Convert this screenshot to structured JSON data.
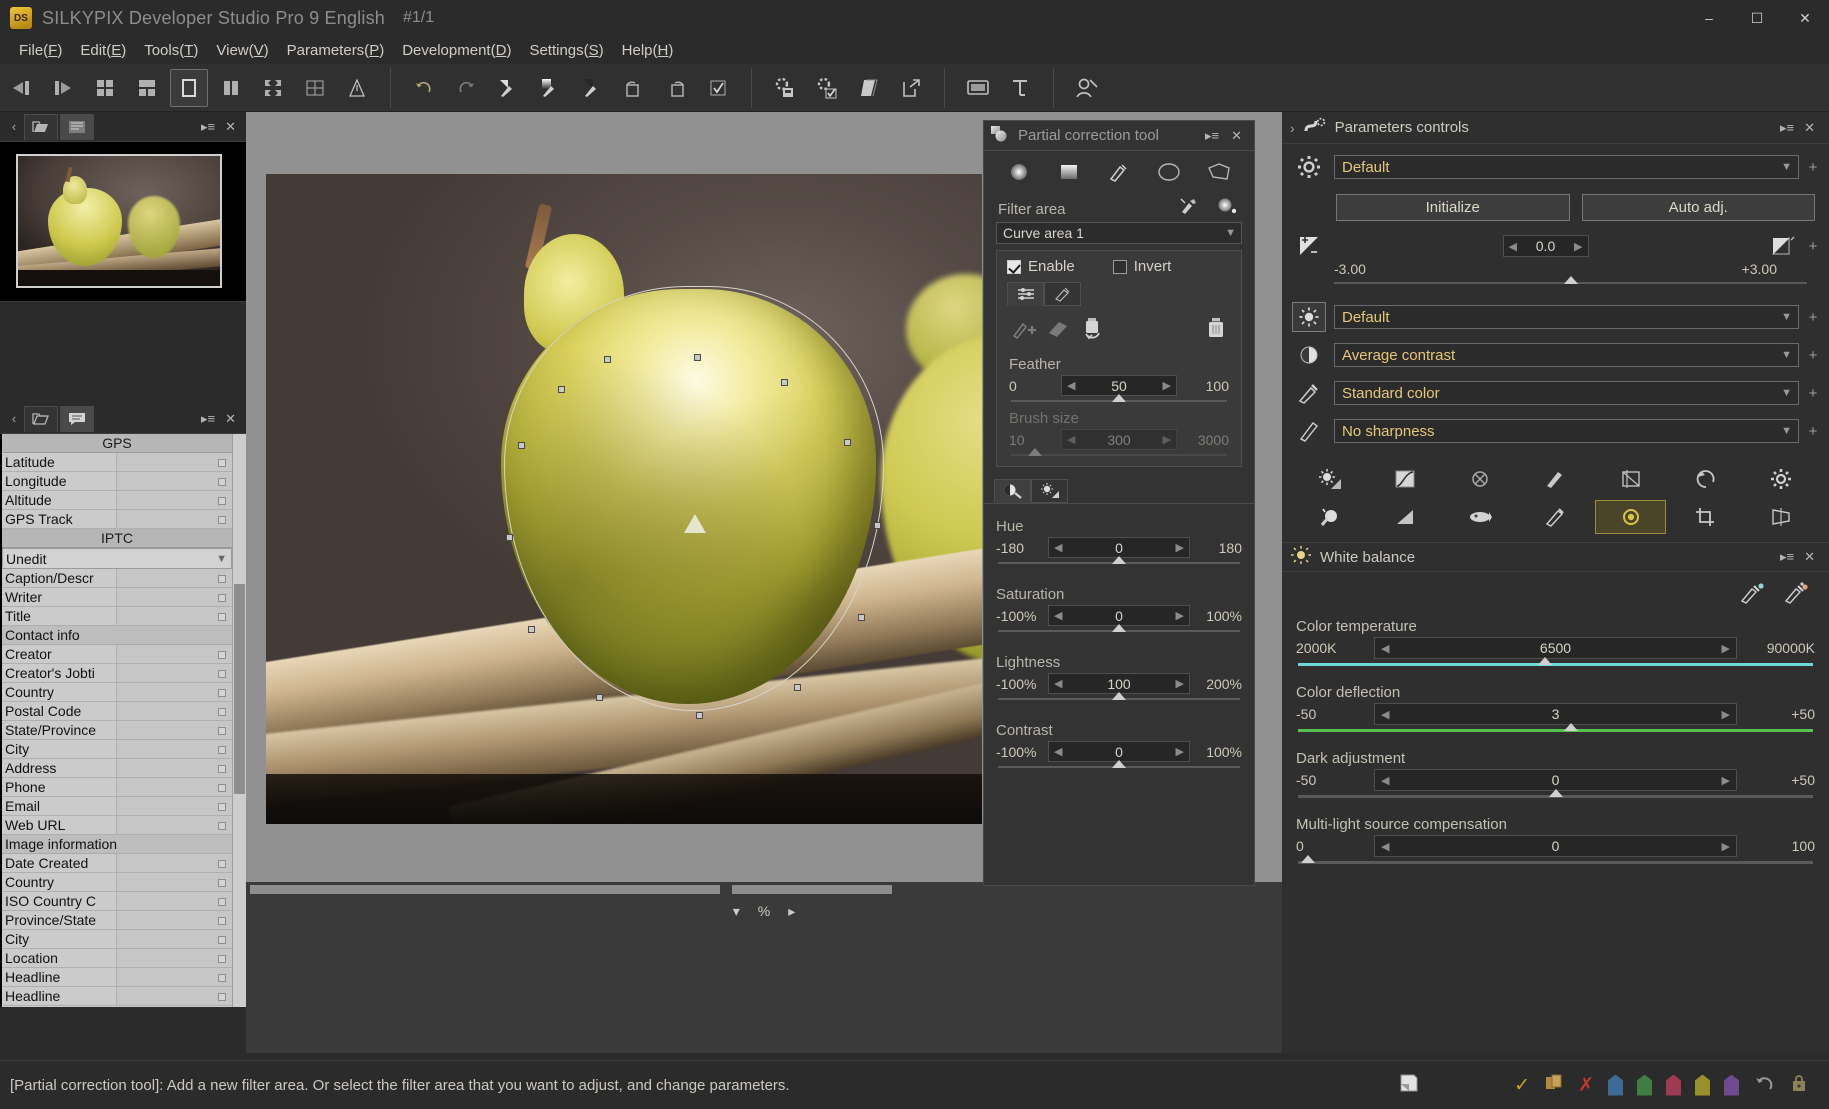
{
  "window": {
    "title": "SILKYPIX Developer Studio Pro 9 English",
    "index": "#1/1",
    "logo_text": "DS",
    "minimize": "–",
    "maximize": "☐",
    "close": "✕"
  },
  "menu": [
    {
      "label": "File",
      "accel": "F"
    },
    {
      "label": "Edit",
      "accel": "E"
    },
    {
      "label": "Tools",
      "accel": "T"
    },
    {
      "label": "View",
      "accel": "V"
    },
    {
      "label": "Parameters",
      "accel": "P"
    },
    {
      "label": "Development",
      "accel": "D"
    },
    {
      "label": "Settings",
      "accel": "S"
    },
    {
      "label": "Help",
      "accel": "H"
    }
  ],
  "toolbar": {
    "groups": [
      [
        "previous-image",
        "next-image",
        "thumbnail-view",
        "combination-view",
        "single-view",
        "compare-view",
        "fit-view",
        "grid-view",
        "warning-view"
      ],
      [
        "undo",
        "redo",
        "taste-tool",
        "gradation-tool",
        "tone-tool",
        "rotate-left",
        "rotate-right",
        "select-check"
      ],
      [
        "batch-develop",
        "develop-check",
        "print",
        "export"
      ],
      [
        "screen-mode",
        "slideshow",
        "text-tool"
      ],
      [
        "user-account"
      ]
    ]
  },
  "left_panel": {
    "tabs": [
      "folder-tab",
      "metadata-tab"
    ],
    "selected_tab": "metadata-tab",
    "thumbnail_label": "",
    "metadata": [
      {
        "type": "section",
        "label": "GPS"
      },
      {
        "type": "row",
        "label": "Latitude",
        "value": ""
      },
      {
        "type": "row",
        "label": "Longitude",
        "value": ""
      },
      {
        "type": "row",
        "label": "Altitude",
        "value": ""
      },
      {
        "type": "row",
        "label": "GPS Track",
        "value": ""
      },
      {
        "type": "section",
        "label": "IPTC"
      },
      {
        "type": "combo",
        "label": "Unedit",
        "value": "Unedit"
      },
      {
        "type": "row",
        "label": "Caption/Descr",
        "value": ""
      },
      {
        "type": "row",
        "label": "Writer",
        "value": ""
      },
      {
        "type": "row",
        "label": "Title",
        "value": ""
      },
      {
        "type": "group",
        "label": "Contact info"
      },
      {
        "type": "row",
        "label": "Creator",
        "value": ""
      },
      {
        "type": "row",
        "label": "Creator's Jobti",
        "value": ""
      },
      {
        "type": "row",
        "label": "Country",
        "value": ""
      },
      {
        "type": "row",
        "label": "Postal Code",
        "value": ""
      },
      {
        "type": "row",
        "label": "State/Province",
        "value": ""
      },
      {
        "type": "row",
        "label": "City",
        "value": ""
      },
      {
        "type": "row",
        "label": "Address",
        "value": ""
      },
      {
        "type": "row",
        "label": "Phone",
        "value": ""
      },
      {
        "type": "row",
        "label": "Email",
        "value": ""
      },
      {
        "type": "row",
        "label": "Web URL",
        "value": ""
      },
      {
        "type": "group",
        "label": "Image information"
      },
      {
        "type": "row",
        "label": "Date Created",
        "value": ""
      },
      {
        "type": "row",
        "label": "Country",
        "value": ""
      },
      {
        "type": "row",
        "label": "ISO Country C",
        "value": ""
      },
      {
        "type": "row",
        "label": "Province/State",
        "value": ""
      },
      {
        "type": "row",
        "label": "City",
        "value": ""
      },
      {
        "type": "row",
        "label": "Location",
        "value": ""
      },
      {
        "type": "row",
        "label": "Headline",
        "value": ""
      },
      {
        "type": "row",
        "label": "Headline",
        "value": ""
      }
    ]
  },
  "viewer": {
    "zoom_unit": "%"
  },
  "partial_correction": {
    "title": "Partial correction tool",
    "tools": [
      "circular-gradient-tool",
      "linear-gradient-tool",
      "brush-tool",
      "ellipse-tool",
      "polygon-tool"
    ],
    "filter_area_label": "Filter area",
    "filter_area_value": "Curve area 1",
    "enable_label": "Enable",
    "enable_checked": true,
    "invert_label": "Invert",
    "invert_checked": false,
    "minitabs": [
      "slider-mode-tab",
      "brush-mode-tab"
    ],
    "brush_tools": [
      "add-brush-icon",
      "eraser-icon",
      "reset-area-icon",
      "trash-icon"
    ],
    "feather": {
      "label": "Feather",
      "min": "0",
      "value": "50",
      "max": "100",
      "knob_pct": 50
    },
    "brush_size": {
      "label": "Brush size",
      "min": "10",
      "value": "300",
      "max": "3000",
      "knob_pct": 10
    },
    "adjust_tabs": [
      "color-adjust-tab",
      "exposure-adjust-tab"
    ],
    "sliders": [
      {
        "label": "Hue",
        "min": "-180",
        "value": "0",
        "max": "180",
        "knob_pct": 50
      },
      {
        "label": "Saturation",
        "min": "-100%",
        "value": "0",
        "max": "100%",
        "knob_pct": 50
      },
      {
        "label": "Lightness",
        "min": "-100%",
        "value": "100",
        "max": "200%",
        "knob_pct": 50
      },
      {
        "label": "Contrast",
        "min": "-100%",
        "value": "0",
        "max": "100%",
        "knob_pct": 50
      }
    ]
  },
  "parameters_controls": {
    "title": "Parameters controls",
    "taste": {
      "value": "Default",
      "initialize": "Initialize",
      "auto_adj": "Auto adj."
    },
    "exposure": {
      "min": "-3.00",
      "value": "0.0",
      "max": "+3.00",
      "knob_pct": 50
    },
    "tone": {
      "value": "Default"
    },
    "contrast": {
      "value": "Average contrast"
    },
    "color": {
      "value": "Standard color"
    },
    "sharpness": {
      "value": "No sharpness"
    },
    "icon_grid": [
      "exposure-bias-icon",
      "tone-curve-icon",
      "noise-reduction-icon",
      "sharpness-icon",
      "hsv-icon",
      "rotation-icon",
      "settings-icon",
      "dodge-burn-icon",
      "gradation-icon",
      "lens-aberration-icon",
      "partial-correction-icon",
      "highlight-controller-icon",
      "crop-icon",
      "perspective-icon"
    ],
    "icon_grid_selected": "highlight-controller-icon"
  },
  "white_balance": {
    "title": "White balance",
    "picker_icons": [
      "gray-balance-picker-icon",
      "skin-color-picker-icon"
    ],
    "sliders": [
      {
        "label": "Color temperature",
        "min": "2000K",
        "value": "6500",
        "max": "90000K",
        "knob_pct": 48,
        "track_color": "#6fd8d8"
      },
      {
        "label": "Color deflection",
        "min": "-50",
        "value": "3",
        "max": "+50",
        "knob_pct": 53,
        "track_color": "#55c24e"
      },
      {
        "label": "Dark adjustment",
        "min": "-50",
        "value": "0",
        "max": "+50",
        "knob_pct": 50,
        "track_color": "#5a5a5a"
      },
      {
        "label": "Multi-light source compensation",
        "min": "0",
        "value": "0",
        "max": "100",
        "knob_pct": 2,
        "track_color": "#5a5a5a"
      }
    ]
  },
  "statusbar": {
    "message": "[Partial correction tool]: Add a new filter area. Or select the filter area that you want to adjust, and change parameters.",
    "tags": [
      {
        "name": "check-mark",
        "color": "#c9a22c"
      },
      {
        "name": "copy-icon",
        "color": "#b08a3a"
      },
      {
        "name": "cross-mark",
        "color": "#c0392b"
      },
      {
        "name": "blue-tag",
        "color": "#3d6b93"
      },
      {
        "name": "green-tag",
        "color": "#3f7d42"
      },
      {
        "name": "red-tag",
        "color": "#9e3a52"
      },
      {
        "name": "yellow-tag",
        "color": "#97912b"
      },
      {
        "name": "purple-tag",
        "color": "#6f4a8e"
      },
      {
        "name": "undo-arrow",
        "color": "#9a9a9a"
      },
      {
        "name": "lock-icon",
        "color": "#8e8257"
      }
    ]
  }
}
